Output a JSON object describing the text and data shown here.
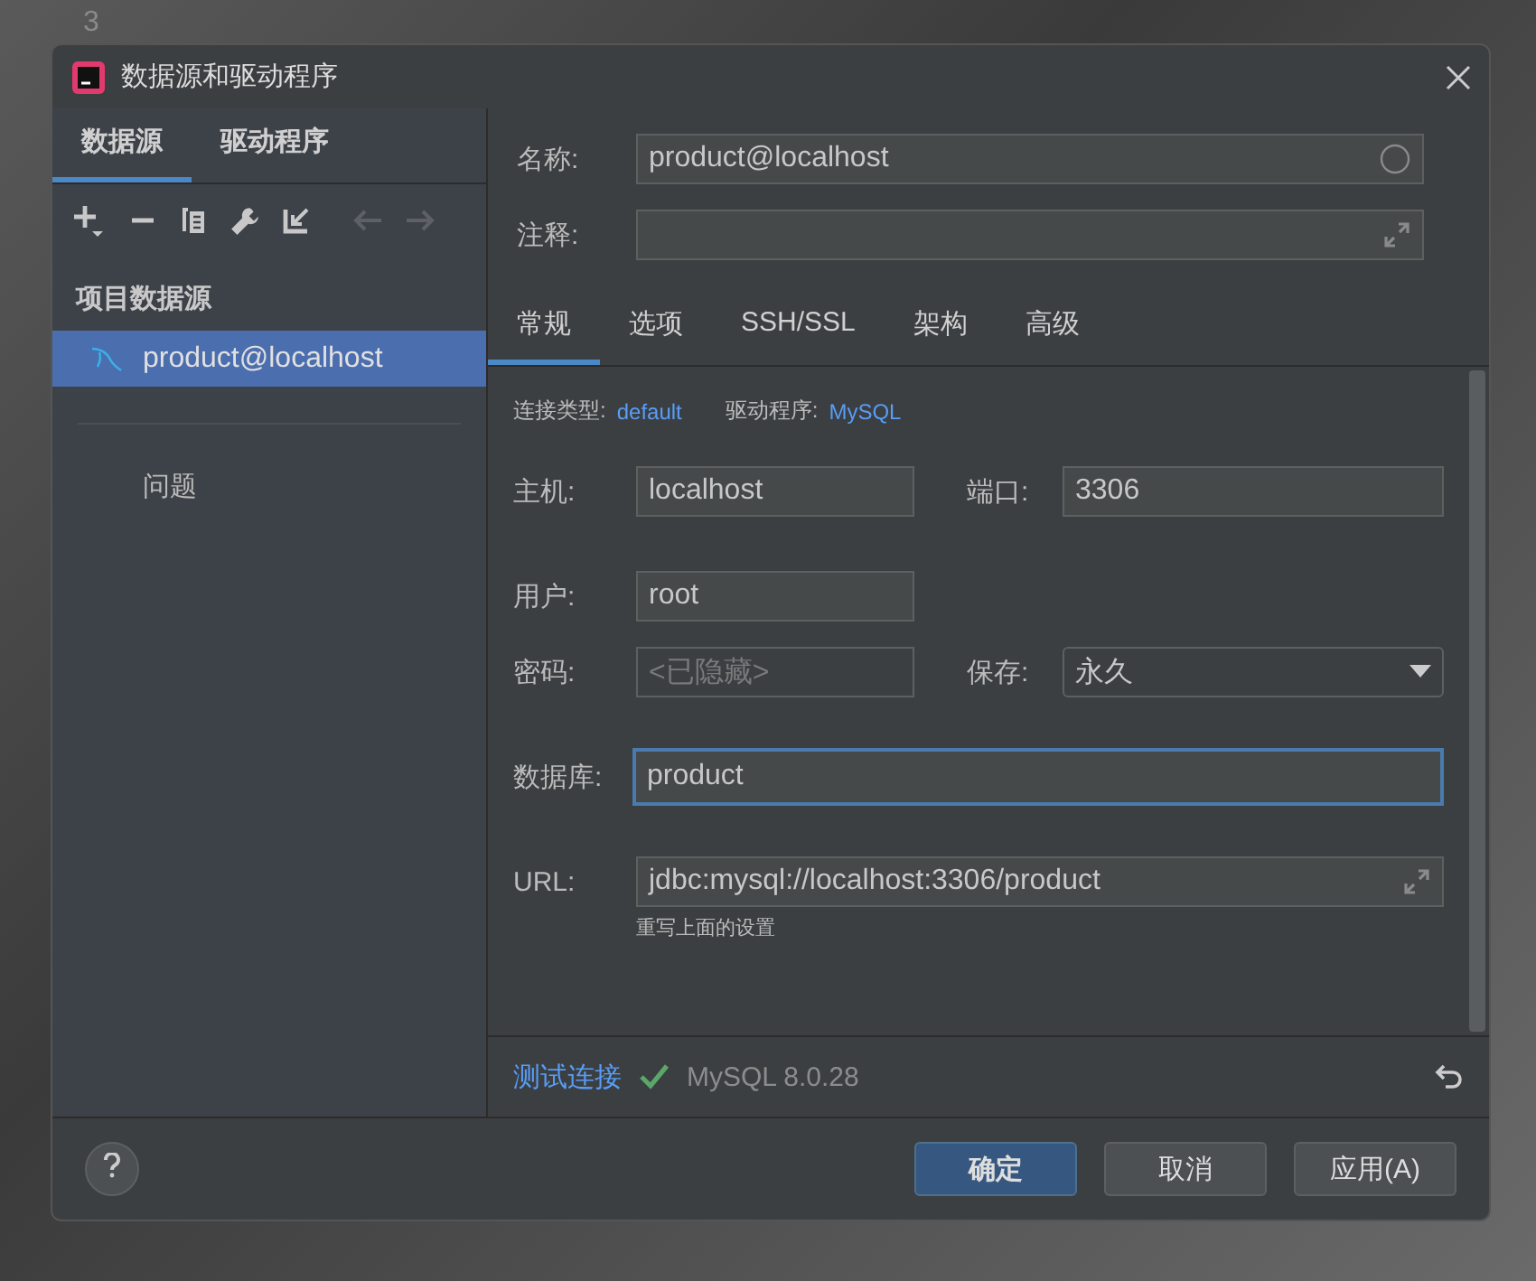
{
  "background_editor": {
    "line_number": "3"
  },
  "window": {
    "title": "数据源和驱动程序"
  },
  "left_tabs": [
    {
      "label": "数据源",
      "selected": true
    },
    {
      "label": "驱动程序",
      "selected": false
    }
  ],
  "toolbar": [
    {
      "kind": "add",
      "disabled": false
    },
    {
      "kind": "remove",
      "disabled": false
    },
    {
      "kind": "copy",
      "disabled": false
    },
    {
      "kind": "wrench",
      "disabled": false
    },
    {
      "kind": "import",
      "disabled": false
    },
    {
      "kind": "back",
      "disabled": true
    },
    {
      "kind": "forward",
      "disabled": true
    }
  ],
  "section_title": "项目数据源",
  "data_sources": [
    {
      "name": "product@localhost",
      "selected": true
    }
  ],
  "problems_label": "问题",
  "name_field": {
    "label": "名称:",
    "value": "product@localhost"
  },
  "comment_field": {
    "label": "注释:"
  },
  "tabs": [
    {
      "label": "常规",
      "selected": true
    },
    {
      "label": "选项",
      "selected": false
    },
    {
      "label": "SSH/SSL",
      "selected": false
    },
    {
      "label": "架构",
      "selected": false
    },
    {
      "label": "高级",
      "selected": false
    }
  ],
  "connection_type": {
    "label": "连接类型:",
    "value": "default"
  },
  "driver": {
    "label": "驱动程序:",
    "value": "MySQL"
  },
  "host": {
    "label": "主机:",
    "value": "localhost"
  },
  "port": {
    "label": "端口:",
    "value": "3306"
  },
  "user": {
    "label": "用户:",
    "value": "root"
  },
  "password": {
    "label": "密码:",
    "placeholder": "<已隐藏>"
  },
  "save": {
    "label": "保存:",
    "value": "永久"
  },
  "database": {
    "label": "数据库:",
    "value": "product",
    "focused": true
  },
  "url": {
    "label": "URL:",
    "value": "jdbc:mysql://localhost:3306/product",
    "hint": "重写上面的设置"
  },
  "test": {
    "link": "测试连接",
    "ok": true,
    "version": "MySQL 8.0.28"
  },
  "buttons": [
    {
      "label": "确定",
      "kind": "primary"
    },
    {
      "label": "取消",
      "kind": "default"
    },
    {
      "label": "应用(A)",
      "kind": "default"
    }
  ]
}
